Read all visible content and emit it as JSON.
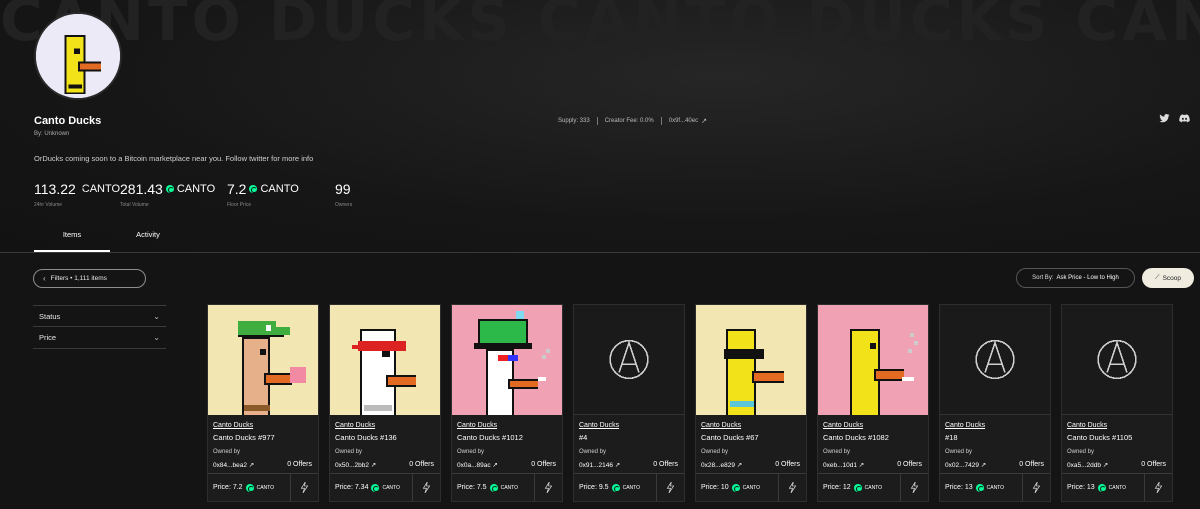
{
  "banner": {
    "watermark": "CANTO DUCKS  CANTO DUCKS  CANTO DUCKS  CANTO"
  },
  "collection": {
    "name": "Canto Ducks",
    "by": "By: Unknown",
    "description": "OrDucks coming soon to a Bitcoin marketplace near you. Follow twitter for more info",
    "supply": "Supply: 333",
    "creator_fee": "Creator Fee: 0.0%",
    "address": "0x9f...40ec"
  },
  "stats": [
    {
      "value": "113.22",
      "currency": "CANTO",
      "label": "24hr Volume"
    },
    {
      "value": "281.43",
      "currency": "CANTO",
      "label": "Total Volume"
    },
    {
      "value": "7.2",
      "currency": "CANTO",
      "label": "Floor Price"
    },
    {
      "value": "99",
      "currency": "",
      "label": "Owners"
    }
  ],
  "tabs": [
    {
      "label": "Items",
      "active": true
    },
    {
      "label": "Activity",
      "active": false
    }
  ],
  "toolbar": {
    "filters_label": "Filters • 1,111 items",
    "sort_prefix": "Sort By:",
    "sort_value": "Ask Price - Low to High",
    "scoop_label": "Scoop"
  },
  "filters": [
    {
      "label": "Status"
    },
    {
      "label": "Price"
    }
  ],
  "colors": {
    "accent": "#06fc99",
    "bg": "#141414"
  },
  "items": [
    {
      "collection": "Canto Ducks",
      "title": "Canto Ducks #977",
      "owned_by": "Owned by",
      "owner": "0x84...bea2",
      "offers": "0 Offers",
      "price": "Price: 7.2",
      "currency": "CANTO",
      "art": "duck-green-cap"
    },
    {
      "collection": "Canto Ducks",
      "title": "Canto Ducks #136",
      "owned_by": "Owned by",
      "owner": "0x50...2bb2",
      "offers": "0 Offers",
      "price": "Price: 7.34",
      "currency": "CANTO",
      "art": "duck-white-bandana"
    },
    {
      "collection": "Canto Ducks",
      "title": "Canto Ducks #1012",
      "owned_by": "Owned by",
      "owner": "0x0a...89ac",
      "offers": "0 Offers",
      "price": "Price: 7.5",
      "currency": "CANTO",
      "art": "duck-white-green-hat"
    },
    {
      "collection": "Canto Ducks",
      "title": "#4",
      "owned_by": "Owned by",
      "owner": "0x91...2146",
      "offers": "0 Offers",
      "price": "Price: 9.5",
      "currency": "CANTO",
      "art": "placeholder"
    },
    {
      "collection": "Canto Ducks",
      "title": "Canto Ducks #67",
      "owned_by": "Owned by",
      "owner": "0x28...e829",
      "offers": "0 Offers",
      "price": "Price: 10",
      "currency": "CANTO",
      "art": "duck-yellow-shades"
    },
    {
      "collection": "Canto Ducks",
      "title": "Canto Ducks #1082",
      "owned_by": "Owned by",
      "owner": "0xeb...10d1",
      "offers": "0 Offers",
      "price": "Price: 12",
      "currency": "CANTO",
      "art": "duck-yellow-pink"
    },
    {
      "collection": "Canto Ducks",
      "title": "#18",
      "owned_by": "Owned by",
      "owner": "0x02...7429",
      "offers": "0 Offers",
      "price": "Price: 13",
      "currency": "CANTO",
      "art": "placeholder"
    },
    {
      "collection": "Canto Ducks",
      "title": "Canto Ducks #1105",
      "owned_by": "Owned by",
      "owner": "0xa5...2ddb",
      "offers": "0 Offers",
      "price": "Price: 13",
      "currency": "CANTO",
      "art": "placeholder"
    }
  ]
}
